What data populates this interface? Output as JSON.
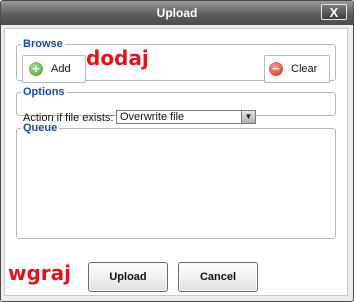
{
  "window": {
    "title": "Upload",
    "close_label": "X"
  },
  "browse": {
    "legend": "Browse",
    "add_label": "Add",
    "clear_label": "Clear",
    "add_icon": "plus-icon",
    "clear_icon": "minus-icon"
  },
  "options": {
    "legend": "Options",
    "action_label": "Action if file exists:",
    "action_value": "Overwrite file"
  },
  "queue": {
    "legend": "Queue"
  },
  "footer": {
    "upload_label": "Upload",
    "cancel_label": "Cancel"
  },
  "annotations": {
    "add_note": "dodaj",
    "upload_note": "wgraj"
  },
  "colors": {
    "legend": "#1a4aa0",
    "annotation": "#e4121b",
    "titlebar": "#5e5e5e"
  }
}
